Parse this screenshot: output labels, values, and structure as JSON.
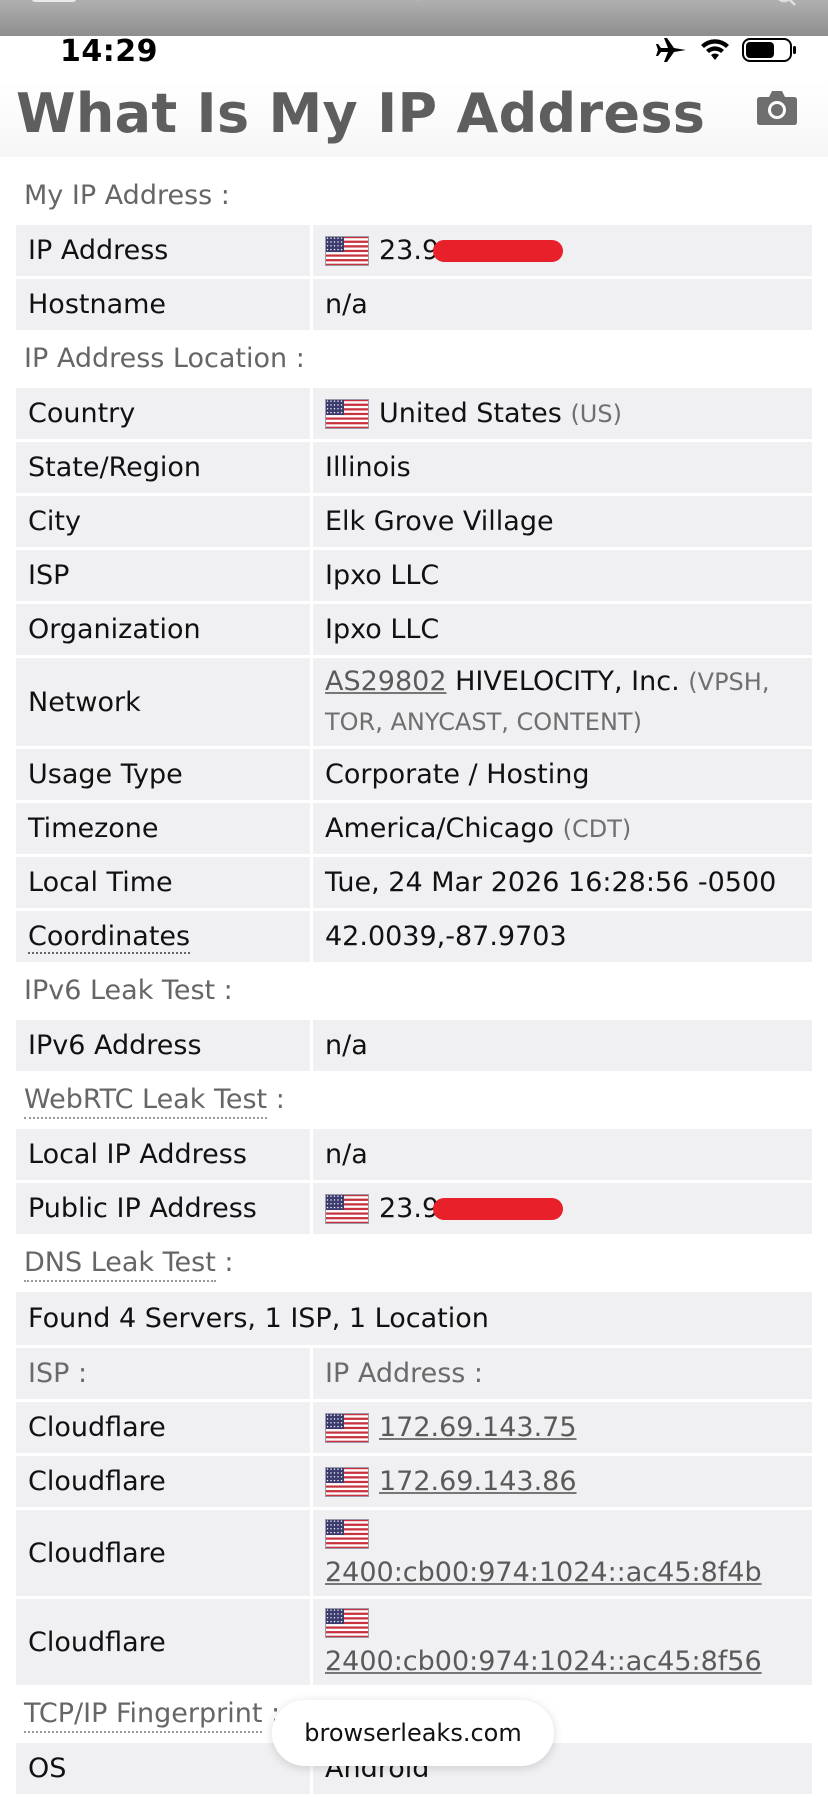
{
  "status_bar": {
    "time": "14:29"
  },
  "page": {
    "title": "What Is My IP Address"
  },
  "sections": {
    "my_ip": "My IP Address :",
    "location": "IP Address Location :",
    "ipv6": "IPv6 Leak Test :",
    "webrtc": "WebRTC Leak Test",
    "webrtc_colon": " :",
    "dns": "DNS Leak Test",
    "dns_colon": " :",
    "tcp": "TCP/IP Fingerprint",
    "tcp_colon": " :"
  },
  "my_ip": {
    "ip_label": "IP Address",
    "ip_value": "23.9",
    "hostname_label": "Hostname",
    "hostname_value": "n/a"
  },
  "location": {
    "country_label": "Country",
    "country_value": "United States",
    "country_code": "(US)",
    "state_label": "State/Region",
    "state_value": "Illinois",
    "city_label": "City",
    "city_value": "Elk Grove Village",
    "isp_label": "ISP",
    "isp_value": "Ipxo LLC",
    "org_label": "Organization",
    "org_value": "Ipxo LLC",
    "network_label": "Network",
    "network_asn": "AS29802",
    "network_name": "HIVELOCITY, Inc.",
    "network_tags_1": "(VPSH,",
    "network_tags_2": "TOR, ANYCAST, CONTENT)",
    "usage_label": "Usage Type",
    "usage_value": "Corporate / Hosting",
    "timezone_label": "Timezone",
    "timezone_value": "America/Chicago",
    "timezone_abbr": "(CDT)",
    "localtime_label": "Local Time",
    "localtime_value": "Tue, 24 Mar 2026 16:28:56 -0500",
    "coords_label": "Coordinates",
    "coords_value": "42.0039,-87.9703"
  },
  "ipv6": {
    "label": "IPv6 Address",
    "value": "n/a"
  },
  "webrtc": {
    "local_label": "Local IP Address",
    "local_value": "n/a",
    "public_label": "Public IP Address",
    "public_value": "23.9"
  },
  "dns": {
    "summary": "Found 4 Servers, 1 ISP, 1 Location",
    "col_isp": "ISP :",
    "col_ip": "IP Address :",
    "servers": [
      {
        "isp": "Cloudflare",
        "ip": "172.69.143.75"
      },
      {
        "isp": "Cloudflare",
        "ip": "172.69.143.86"
      },
      {
        "isp": "Cloudflare",
        "ip": "2400:cb00:974:1024::ac45:8f4b"
      },
      {
        "isp": "Cloudflare",
        "ip": "2400:cb00:974:1024::ac45:8f56"
      }
    ]
  },
  "tcp": {
    "os_label": "OS",
    "os_value": "Android"
  },
  "toast": {
    "text": "browserleaks.com"
  },
  "colors": {
    "redaction": "#e8202a",
    "title": "#5e5e5e",
    "row_bg": "#f0f0f3"
  },
  "icons": [
    "menu-icon",
    "loading-icon",
    "search-icon",
    "airplane-icon",
    "wifi-icon",
    "battery-icon",
    "camera-icon",
    "us-flag-icon"
  ]
}
